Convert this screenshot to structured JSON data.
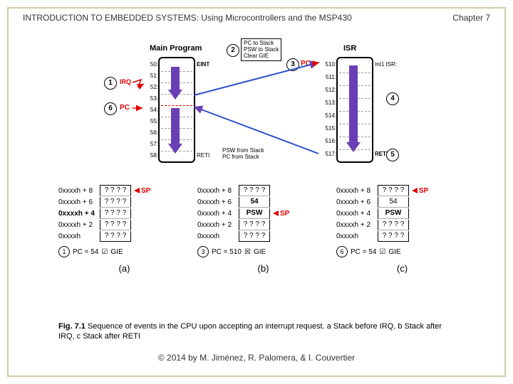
{
  "header": {
    "title": "INTRODUCTION TO EMBEDDED SYSTEMS: Using Microcontrollers and the MSP430",
    "chapter": "Chapter 7"
  },
  "footer": "© 2014 by M. Jiménez, R. Palomera, & I. Couvertier",
  "diagram": {
    "main_title": "Main Program",
    "isr_title": "ISR",
    "main_addrs": [
      "50:",
      "51:",
      "52:",
      "53:",
      "54:",
      "55:",
      "56:",
      "57:",
      "58:"
    ],
    "main_instr": [
      "EINT",
      "----",
      "----",
      "----",
      "----",
      "----",
      "----",
      "----",
      "RETI"
    ],
    "isr_addrs": [
      "510:",
      "511:",
      "512:",
      "513:",
      "514:",
      "515:",
      "516:",
      "517:"
    ],
    "isr_instr": [
      "Int1 ISR:",
      "----",
      "----",
      "----",
      "----",
      "----",
      "----",
      "RETI"
    ],
    "callouts": {
      "c1": "1",
      "c2": "2",
      "c3": "3",
      "c4": "4",
      "c5": "5",
      "c6": "6"
    },
    "side": {
      "irq": "IRQ",
      "pc3": "PC",
      "pc6": "PC"
    },
    "note_top": [
      "PC to Stack",
      "PSW to Stack",
      "Clear GIE"
    ],
    "note_bot": [
      "PSW from Stack",
      "PC from Stack"
    ]
  },
  "stacks": {
    "addrs": [
      "0xxxxh + 8",
      "0xxxxh + 6",
      "0xxxxh + 4",
      "0xxxxh + 2",
      "0xxxxh"
    ],
    "a": {
      "cells": [
        "? ? ? ?",
        "? ? ? ?",
        "? ? ? ?",
        "? ? ? ?",
        "? ? ? ?"
      ],
      "sp_row": 0,
      "bold_addr_row": 3
    },
    "b": {
      "cells": [
        "? ? ? ?",
        "54",
        "PSW",
        "? ? ? ?",
        "? ? ? ?"
      ],
      "sp_row": 2,
      "bold_rows": [
        1,
        2
      ]
    },
    "c": {
      "cells": [
        "? ? ? ?",
        "54",
        "PSW",
        "? ? ? ?",
        "? ? ? ?"
      ],
      "sp_row": 0,
      "bold_rows": [
        2
      ]
    },
    "sp": "SP",
    "state_a": {
      "num": "1",
      "pc": "PC = 54",
      "gie": "GIE",
      "checked": true
    },
    "state_b": {
      "num": "3",
      "pc": "PC = 510",
      "gie": "GIE",
      "checked": false
    },
    "state_c": {
      "num": "6",
      "pc": "PC = 54",
      "gie": "GIE",
      "checked": true
    },
    "labels": {
      "a": "(a)",
      "b": "(b)",
      "c": "(c)"
    }
  },
  "caption": {
    "fignum": "Fig. 7.1",
    "text": "Sequence of events in the CPU upon accepting an interrupt request. a Stack before IRQ, b Stack after IRQ, c Stack after RETI"
  }
}
